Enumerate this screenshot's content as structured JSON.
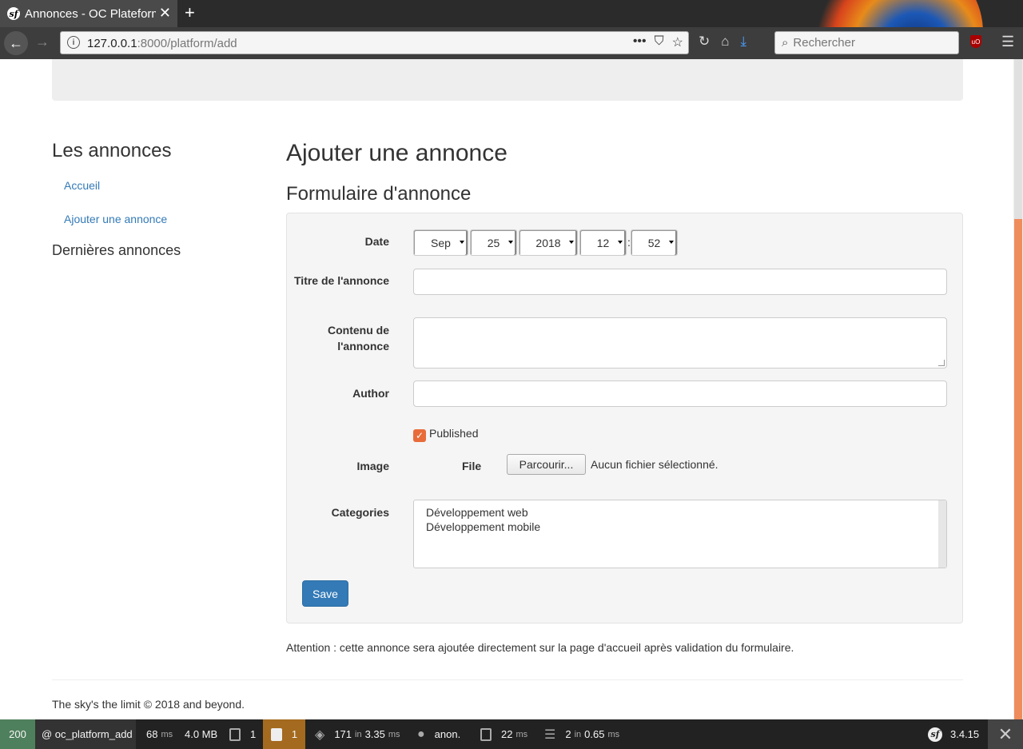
{
  "browser": {
    "tab_title": "Annonces - OC Plateform",
    "tab_close": "✕",
    "new_tab": "+",
    "url_host": "127.0.0.1",
    "url_path": ":8000/platform/add",
    "search_placeholder": "Rechercher"
  },
  "sidebar": {
    "title": "Les annonces",
    "links": [
      "Accueil",
      "Ajouter une annonce"
    ],
    "latest_title": "Dernières annonces"
  },
  "main": {
    "title": "Ajouter une annonce",
    "form_title": "Formulaire d'annonce"
  },
  "form": {
    "date_label": "Date",
    "date": {
      "month": "Sep",
      "day": "25",
      "year": "2018",
      "hour": "12",
      "minute": "52",
      "separator": ":"
    },
    "title_label": "Titre de l'annonce",
    "content_label": "Contenu de l'annonce",
    "author_label": "Author",
    "published_label": "Published",
    "published_checked": true,
    "image_label": "Image",
    "file_label": "File",
    "browse_button": "Parcourir...",
    "file_status": "Aucun fichier sélectionné.",
    "categories_label": "Categories",
    "categories": [
      "Développement web",
      "Développement mobile"
    ],
    "save_button": "Save"
  },
  "notice": "Attention : cette annonce sera ajoutée directement sur la page d'accueil après validation du formulaire.",
  "footer": "The sky's the limit © 2018 and beyond.",
  "toolbar": {
    "status_code": "200",
    "route": "@ oc_platform_add",
    "time_value": "68",
    "time_unit": "ms",
    "memory": "4.0 MB",
    "logs_count": "1",
    "warnings_count": "1",
    "twig_count": "171",
    "twig_in": "in",
    "twig_time": "3.35",
    "twig_unit": "ms",
    "user": "anon.",
    "cache_time": "22",
    "cache_unit": "ms",
    "db_count": "2",
    "db_in": "in",
    "db_time": "0.65",
    "db_unit": "ms",
    "version": "3.4.15"
  }
}
